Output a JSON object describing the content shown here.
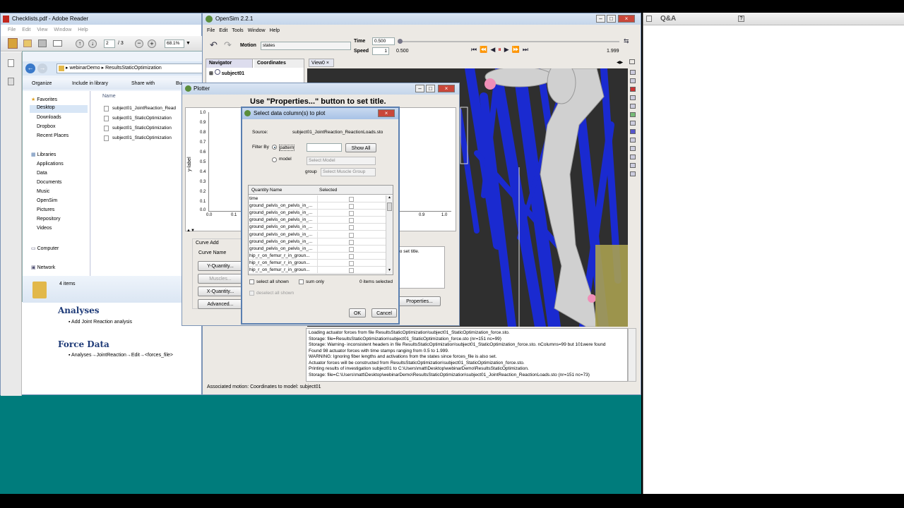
{
  "reader": {
    "title": "Checklists.pdf - Adobe Reader",
    "menu": [
      "File",
      "Edit",
      "View",
      "Window",
      "Help"
    ],
    "page_current": "2",
    "page_total": "/ 3",
    "zoom": "68.1%",
    "headings": {
      "analyses": "Analyses",
      "force_data": "Force Data"
    },
    "bullets": {
      "analyses": "Add Joint Reaction analysis",
      "force_data": "Analyses→JointReaction→Edit→<forces_file>"
    }
  },
  "explorer": {
    "path": [
      "webinarDemo",
      "ResultsStaticOptimization"
    ],
    "toolbar": [
      "Organize",
      "Include in library",
      "Share with",
      "Bu"
    ],
    "name_header": "Name",
    "favorites_label": "Favorites",
    "favorites": [
      "Desktop",
      "Downloads",
      "Dropbox",
      "Recent Places"
    ],
    "libraries_label": "Libraries",
    "libraries": [
      "Applications",
      "Data",
      "Documents",
      "Music",
      "OpenSim",
      "Pictures",
      "Repository",
      "Videos"
    ],
    "computer": "Computer",
    "network": "Network",
    "files": [
      "subject01_JointReaction_Read",
      "subject01_StaticOptimization",
      "subject01_StaticOptimization",
      "subject01_StaticOptimization"
    ],
    "items_count": "4 items"
  },
  "opensim": {
    "title": "OpenSim 2.2.1",
    "menu": [
      "File",
      "Edit",
      "Tools",
      "Window",
      "Help"
    ],
    "motion_label": "Motion",
    "motion_value": "states",
    "time_label": "Time",
    "time_value": "0.500",
    "speed_label": "Speed",
    "speed_value": "1",
    "time_start": "0.500",
    "time_end": "1.999",
    "tabs": {
      "navigator": "Navigator",
      "coordinates": "Coordinates",
      "view": "View0"
    },
    "tree_item": "subject01",
    "status": "Associated motion: Coordinates to model: subject01",
    "log": [
      "Loading actuator forces from file ResultsStaticOptimization\\subject01_StaticOptimization_force.sto.",
      "Storage: file=ResultsStaticOptimization\\subject01_StaticOptimization_force.sto (nr=151 nc=99)",
      "Storage: Warning- inconsistent headers in file ResultsStaticOptimization\\subject01_StaticOptimization_force.sto. nColumns=99 but 101were found",
      "Found 98 actuator forces with time stamps ranging from 0.5 to 1.999.",
      "WARNING: Ignoring fiber lengths and activations from the states since forces_file is also set.",
      "Actuator forces will be constructed from ResultsStaticOptimization\\subject01_StaticOptimization_force.sto.",
      "Printing results of investigation subject01 to C:\\Users\\matt\\Desktop\\webinarDemo\\ResultsStaticOptimization.",
      "Storage: file=C:\\Users\\matt\\Desktop\\webinarDemo\\ResultsStaticOptimization\\subject01_JointReaction_ReactionLoads.sto (nr=151 nc=73)"
    ]
  },
  "plotter": {
    "title": "Plotter",
    "chart_title": "Use \"Properties...\" button to set title.",
    "ylabel": "y-label",
    "y_ticks": [
      "1.0",
      "0.9",
      "0.8",
      "0.7",
      "0.6",
      "0.5",
      "0.4",
      "0.3",
      "0.2",
      "0.1",
      "0.0"
    ],
    "x_ticks_left": [
      "0.0",
      "0.1"
    ],
    "x_ticks_right": [
      "0.9",
      "1.0"
    ],
    "curve_add": "Curve Add",
    "curve_name": "Curve Name",
    "y_quantity": "Y-Quantity...",
    "muscles": "Muscles...",
    "x_quantity": "X-Quantity...",
    "advanced": "Advanced...",
    "properties": "Properties...",
    "title_hint": "to set title."
  },
  "dialog": {
    "title": "Select data column(s) to plot",
    "source_label": "Source:",
    "source_value": "subject01_JointReaction_ReactionLoads.sto",
    "filter_by": "Filter By",
    "pattern": "pattern",
    "show_all": "Show All",
    "model": "model",
    "select_model": "Select Model",
    "group": "group",
    "select_group": "Select Muscle Group",
    "col_quantity": "Quantity Name",
    "col_selected": "Selected",
    "rows": [
      "time",
      "ground_pelvis_on_pelvis_in_...",
      "ground_pelvis_on_pelvis_in_...",
      "ground_pelvis_on_pelvis_in_...",
      "ground_pelvis_on_pelvis_in_...",
      "ground_pelvis_on_pelvis_in_...",
      "ground_pelvis_on_pelvis_in_...",
      "ground_pelvis_on_pelvis_in_...",
      "hip_r_on_femur_r_in_groun...",
      "hip_r_on_femur_r_in_groun...",
      "hip_r_on_femur_r_in_groun...",
      "hip_r_on_femur_r_in_groun..."
    ],
    "select_all": "select all shown",
    "sum_only": "sum only",
    "items_selected": "0 items selected",
    "deselect_all": "deselect all shown",
    "ok": "OK",
    "cancel": "Cancel"
  },
  "qa": {
    "title": "Q&A"
  },
  "colors": {
    "desktop_teal": "#007c7c",
    "muscle_blue": "#1a2ad0",
    "bone_white": "#d8d8d8",
    "titlebar": "#c9d8ec"
  }
}
